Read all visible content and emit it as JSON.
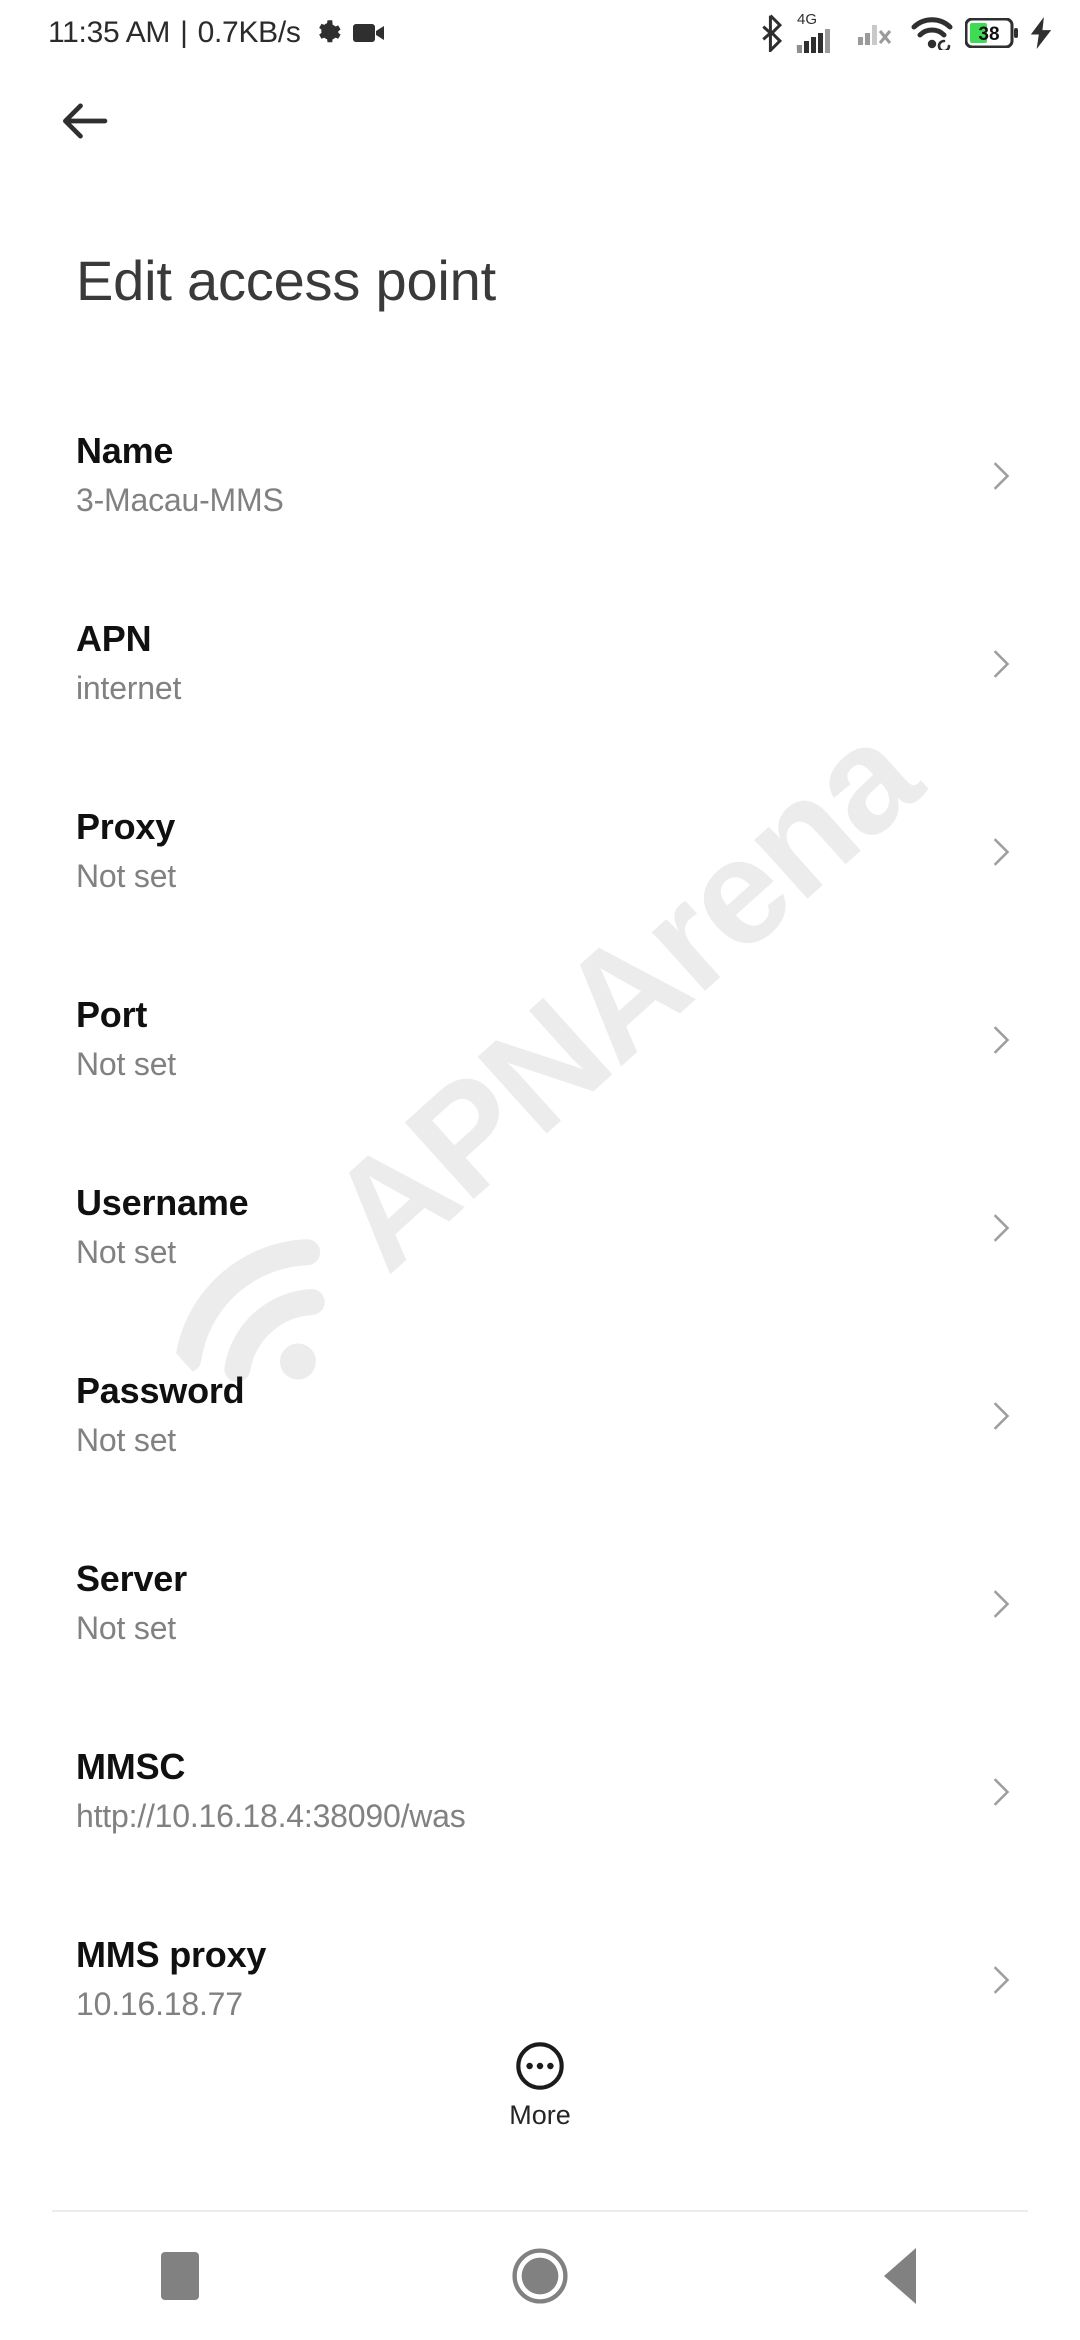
{
  "status_bar": {
    "clock": "11:35 AM",
    "separator": "|",
    "network_speed": "0.7KB/s",
    "left_icons": [
      "gear-icon",
      "video-camera-icon"
    ],
    "right_icons": [
      "bluetooth-icon",
      "signal-4g-icon",
      "signal-no-sim-icon",
      "wifi-icon",
      "battery-icon",
      "charging-bolt-icon"
    ],
    "network_type": "4G",
    "battery_level": "38",
    "colors": {
      "icon": "#2f2f2f",
      "battery_fill": "#3ddc54",
      "battery_text": "#000000"
    }
  },
  "app_bar": {
    "back_icon": "arrow-left-icon"
  },
  "page": {
    "title": "Edit access point"
  },
  "watermark": {
    "text": "APNArena",
    "icon": "wifi-signal-icon",
    "color": "#ececec"
  },
  "settings": {
    "rows": [
      {
        "title": "Name",
        "value": "3-Macau-MMS"
      },
      {
        "title": "APN",
        "value": "internet"
      },
      {
        "title": "Proxy",
        "value": "Not set"
      },
      {
        "title": "Port",
        "value": "Not set"
      },
      {
        "title": "Username",
        "value": "Not set"
      },
      {
        "title": "Password",
        "value": "Not set"
      },
      {
        "title": "Server",
        "value": "Not set"
      },
      {
        "title": "MMSC",
        "value": "http://10.16.18.4:38090/was"
      },
      {
        "title": "MMS proxy",
        "value": "10.16.18.77"
      }
    ],
    "chevron_icon": "chevron-right-icon",
    "chevron_color": "#9e9e9e"
  },
  "more_button": {
    "label": "More",
    "icon": "more-circle-icon"
  },
  "nav_bar": {
    "recents": "recents-square-icon",
    "home": "home-circle-icon",
    "back": "back-triangle-icon",
    "color": "#818181"
  }
}
